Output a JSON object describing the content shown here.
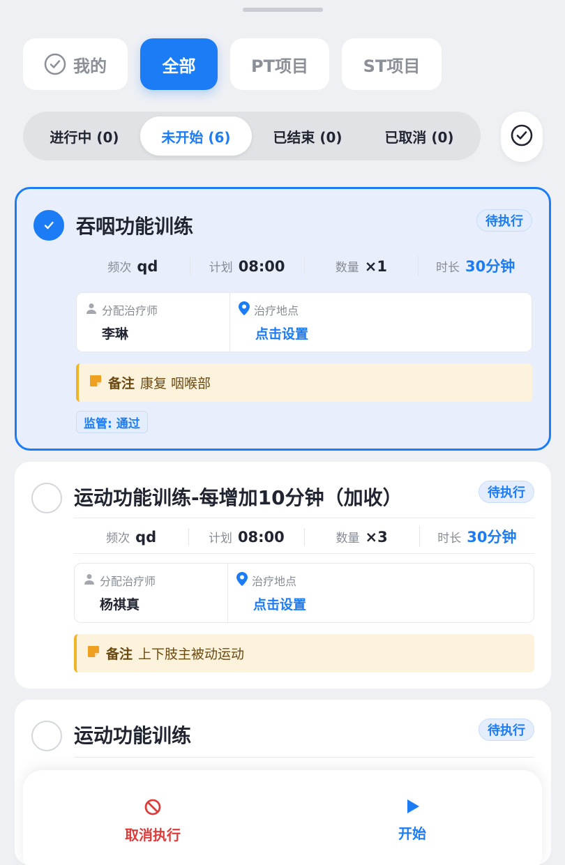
{
  "top_tabs": [
    {
      "label": "我的",
      "icon": "check-circle-icon"
    },
    {
      "label": "全部"
    },
    {
      "label": "PT项目"
    },
    {
      "label": "ST项目"
    }
  ],
  "status_tabs": [
    "进行中 (0)",
    "未开始 (6)",
    "已结束 (0)",
    "已取消 (0)"
  ],
  "colors": {
    "accent": "#1b7cf5",
    "danger": "#e03b3b",
    "note_bg": "#fdf2dc"
  },
  "labels": {
    "freq": "频次",
    "plan": "计划",
    "qty": "数量",
    "duration": "时长",
    "therapist": "分配治疗师",
    "location": "治疗地点",
    "note": "备注"
  },
  "cards": [
    {
      "title": "吞咽功能训练",
      "status": "待执行",
      "selected": true,
      "freq": "qd",
      "plan": "08:00",
      "qty": "×1",
      "duration": "30分钟",
      "therapist": "李琳",
      "location": "点击设置",
      "note": "康复 咽喉部",
      "supervision": "监管: 通过"
    },
    {
      "title": "运动功能训练-每增加10分钟（加收）",
      "status": "待执行",
      "selected": false,
      "freq": "qd",
      "plan": "08:00",
      "qty": "×3",
      "duration": "30分钟",
      "therapist": "杨祺真",
      "location": "点击设置",
      "note": "上下肢主被动运动"
    },
    {
      "title": "运动功能训练",
      "status": "待执行",
      "selected": false
    }
  ],
  "bottom": {
    "cancel_label": "取消执行",
    "start_label": "开始"
  }
}
